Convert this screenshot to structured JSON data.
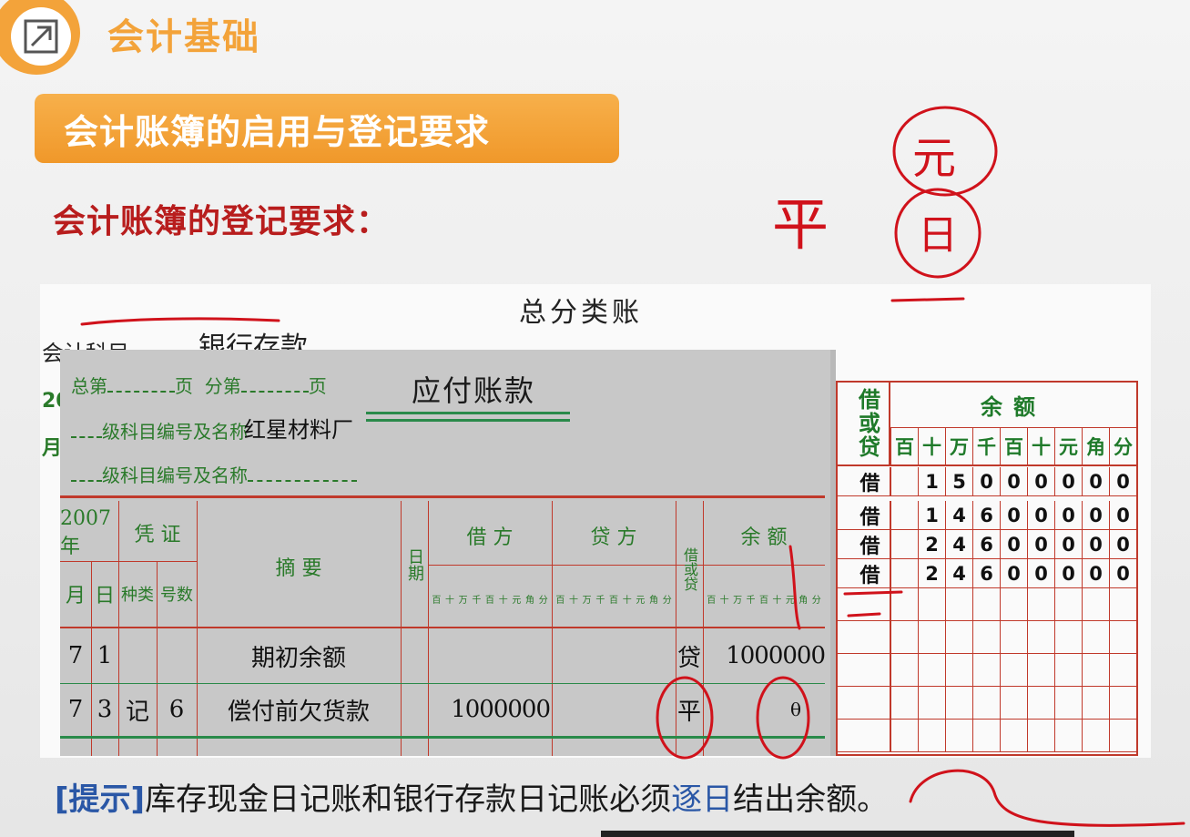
{
  "header": {
    "logo_icon": "arrow-up-right-icon",
    "app_title": "会计基础"
  },
  "section": {
    "banner": "会计账簿的启用与登记要求",
    "subheading": "会计账簿的登记要求："
  },
  "back_ledger": {
    "title": "总分类账",
    "account_label": "会计科目",
    "account_value": "银行存款",
    "left_fragments": [
      "20",
      "月"
    ],
    "dc_header": [
      "借",
      "或",
      "贷"
    ],
    "balance_header": "余额",
    "units": [
      "百",
      "十",
      "万",
      "千",
      "百",
      "十",
      "元",
      "角",
      "分"
    ],
    "rows": [
      {
        "dc": "借",
        "digits": [
          "",
          "1",
          "5",
          "0",
          "0",
          "0",
          "0",
          "0",
          "0"
        ]
      },
      {
        "dc": "借",
        "digits": [
          "",
          "1",
          "4",
          "6",
          "0",
          "0",
          "0",
          "0",
          "0"
        ]
      },
      {
        "dc": "借",
        "digits": [
          "",
          "2",
          "4",
          "6",
          "0",
          "0",
          "0",
          "0",
          "0"
        ]
      },
      {
        "dc": "借",
        "digits": [
          "",
          "2",
          "4",
          "6",
          "0",
          "0",
          "0",
          "0",
          "0"
        ]
      }
    ]
  },
  "front_ledger": {
    "total_page_label": "总第",
    "page_label": "页",
    "sub_page_label": "分第",
    "title": "应付账款",
    "subject_label1": "级科目编号及名称",
    "supplier": "红星材料厂",
    "subject_label2": "级科目编号及名称",
    "year": "2007年",
    "voucher": "凭 证",
    "month": "月",
    "day": "日",
    "voucher_type": "种类",
    "voucher_no": "号数",
    "summary": "摘 要",
    "ref_day": "日期",
    "debit": "借 方",
    "credit": "贷 方",
    "dc": "借或贷",
    "balance": "余 额",
    "mini_units": [
      "百",
      "十",
      "万",
      "千",
      "百",
      "十",
      "元",
      "角",
      "分"
    ],
    "rows": [
      {
        "month": "7",
        "day": "1",
        "type": "",
        "no": "",
        "summary": "期初余额",
        "debit": "",
        "dc": "贷",
        "balance": "1000000"
      },
      {
        "month": "7",
        "day": "3",
        "type": "记",
        "no": "6",
        "summary": "偿付前欠货款",
        "debit": "1000000",
        "dc": "平",
        "balance": "θ"
      }
    ]
  },
  "annotations": {
    "ping": "平",
    "yuan": "元",
    "ri": "日"
  },
  "tip": {
    "tag": "[提示]",
    "text_before": "库存现金日记账和银行存款日记账必须",
    "highlight": "逐日",
    "text_after": "结出余额。"
  },
  "colors": {
    "brand_orange": "#f3a33a",
    "heading_red": "#b81d1d",
    "ledger_red": "#c0392b",
    "ledger_green": "#1f7a2a",
    "tip_blue": "#2a57a6",
    "ink_red": "#d0121b"
  }
}
